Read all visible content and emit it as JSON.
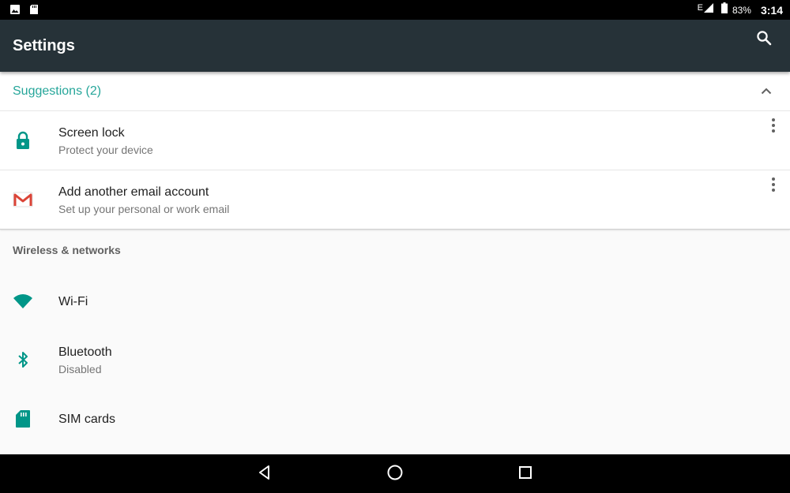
{
  "status_bar": {
    "left_icons": [
      "image-notification-icon",
      "sd-card-notification-icon"
    ],
    "network_label": "E",
    "battery_percent": "83%",
    "time": "3:14"
  },
  "app_bar": {
    "title": "Settings",
    "search_icon": "search-icon"
  },
  "suggestions": {
    "header": "Suggestions (2)",
    "items": [
      {
        "icon": "lock-icon",
        "title": "Screen lock",
        "subtitle": "Protect your device"
      },
      {
        "icon": "gmail-icon",
        "title": "Add another email account",
        "subtitle": "Set up your personal or work email"
      }
    ]
  },
  "sections": [
    {
      "label": "Wireless & networks",
      "items": [
        {
          "icon": "wifi-icon",
          "title": "Wi-Fi"
        },
        {
          "icon": "bluetooth-icon",
          "title": "Bluetooth",
          "subtitle": "Disabled"
        },
        {
          "icon": "sim-card-icon",
          "title": "SIM cards"
        }
      ]
    }
  ],
  "nav_bar": [
    "back-icon",
    "home-icon",
    "recents-icon"
  ],
  "colors": {
    "app_bar": "#263238",
    "accent": "#009688",
    "suggestion_header": "#26a69a",
    "gmail_red": "#db4437"
  }
}
